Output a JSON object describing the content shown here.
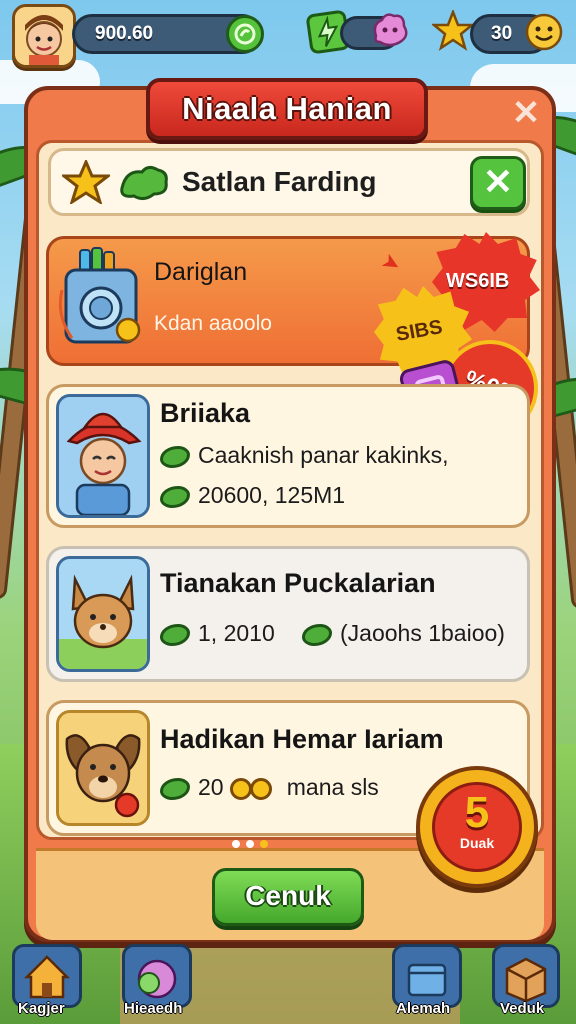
{
  "top_bar": {
    "currency_value": "900.60",
    "score_value": "30"
  },
  "dialog": {
    "title": "Niaala Hanian",
    "close_symbol": "✕",
    "search_text": "Satlan Farding",
    "search_clear_symbol": "✕"
  },
  "cards": [
    {
      "title": "Dariglan",
      "subtitle": "Kdan aaoolo",
      "icon": "washing-machine-icon"
    },
    {
      "title": "Briiaka",
      "line1": "Caaknish panar kakinks,",
      "line2": "20600, 125M1",
      "icon": "farmer-portrait-icon"
    },
    {
      "title": "Tianakan Puckalarian",
      "line1": "1, 2010",
      "line2": "(Jaoohs 1baioo)",
      "icon": "fox-portrait-icon"
    },
    {
      "title": "Hadikan Hemar Iariam",
      "line1": "20",
      "line2": "mana sls",
      "icon": "dog-portrait-icon"
    }
  ],
  "badges": {
    "red": "WS6IB",
    "yellow": "SIBS",
    "percent": "%0%",
    "big_number": "5",
    "big_text": "Duak"
  },
  "footer": {
    "button_label": "Cenuk"
  },
  "bottom_nav": [
    {
      "label": "Kagjer",
      "icon": "house-icon"
    },
    {
      "label": "Hieaedh",
      "icon": "cabbage-icon"
    },
    {
      "label": "Alemah",
      "icon": "crate-icon"
    },
    {
      "label": "Veduk",
      "icon": "box-icon"
    }
  ],
  "colors": {
    "panel": "#f07a4a",
    "banner": "#e0372b",
    "green_button": "#56c33f",
    "card_cream": "#fff6e2"
  }
}
